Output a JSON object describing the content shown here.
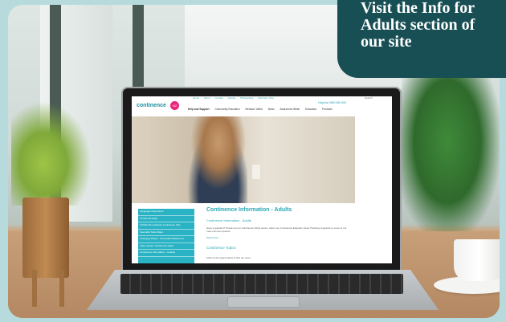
{
  "banner": {
    "text": "Visit the Info for Adults section of our site"
  },
  "site": {
    "top_links": [
      "Home",
      "About",
      "Contact",
      "Donate",
      "Wholesaling",
      "Members Only"
    ],
    "search_label": "Search",
    "logo": "continence",
    "logo_badge": "NZ",
    "helpline": "Helpline 0800 650 659",
    "nav": [
      "Help and Support",
      "Community Education",
      "Medical / Allied",
      "News",
      "Awareness Week",
      "Education",
      "Products"
    ],
    "sidebar": [
      "Language Interpreters",
      "COVID-19 FAQs",
      "COVID-19 Lockdown Continence Tips",
      "Specialist Toilet Maps",
      "Changing Places - Accessible Bathrooms",
      "Video Series: Continence FAQs",
      "Continence Information - Leaking"
    ],
    "content": {
      "title": "Continence Information - Adults",
      "subtitle": "Continence Information - Adults",
      "paragraph": "Have a question? Check out our Continence FAQs series, where our Continence Educator Janet Thackray responds to some of our most common queries.",
      "link": "Watch here",
      "topics_heading": "Continence Topics",
      "topics_note": "Click on the topics below to find out more:"
    }
  }
}
